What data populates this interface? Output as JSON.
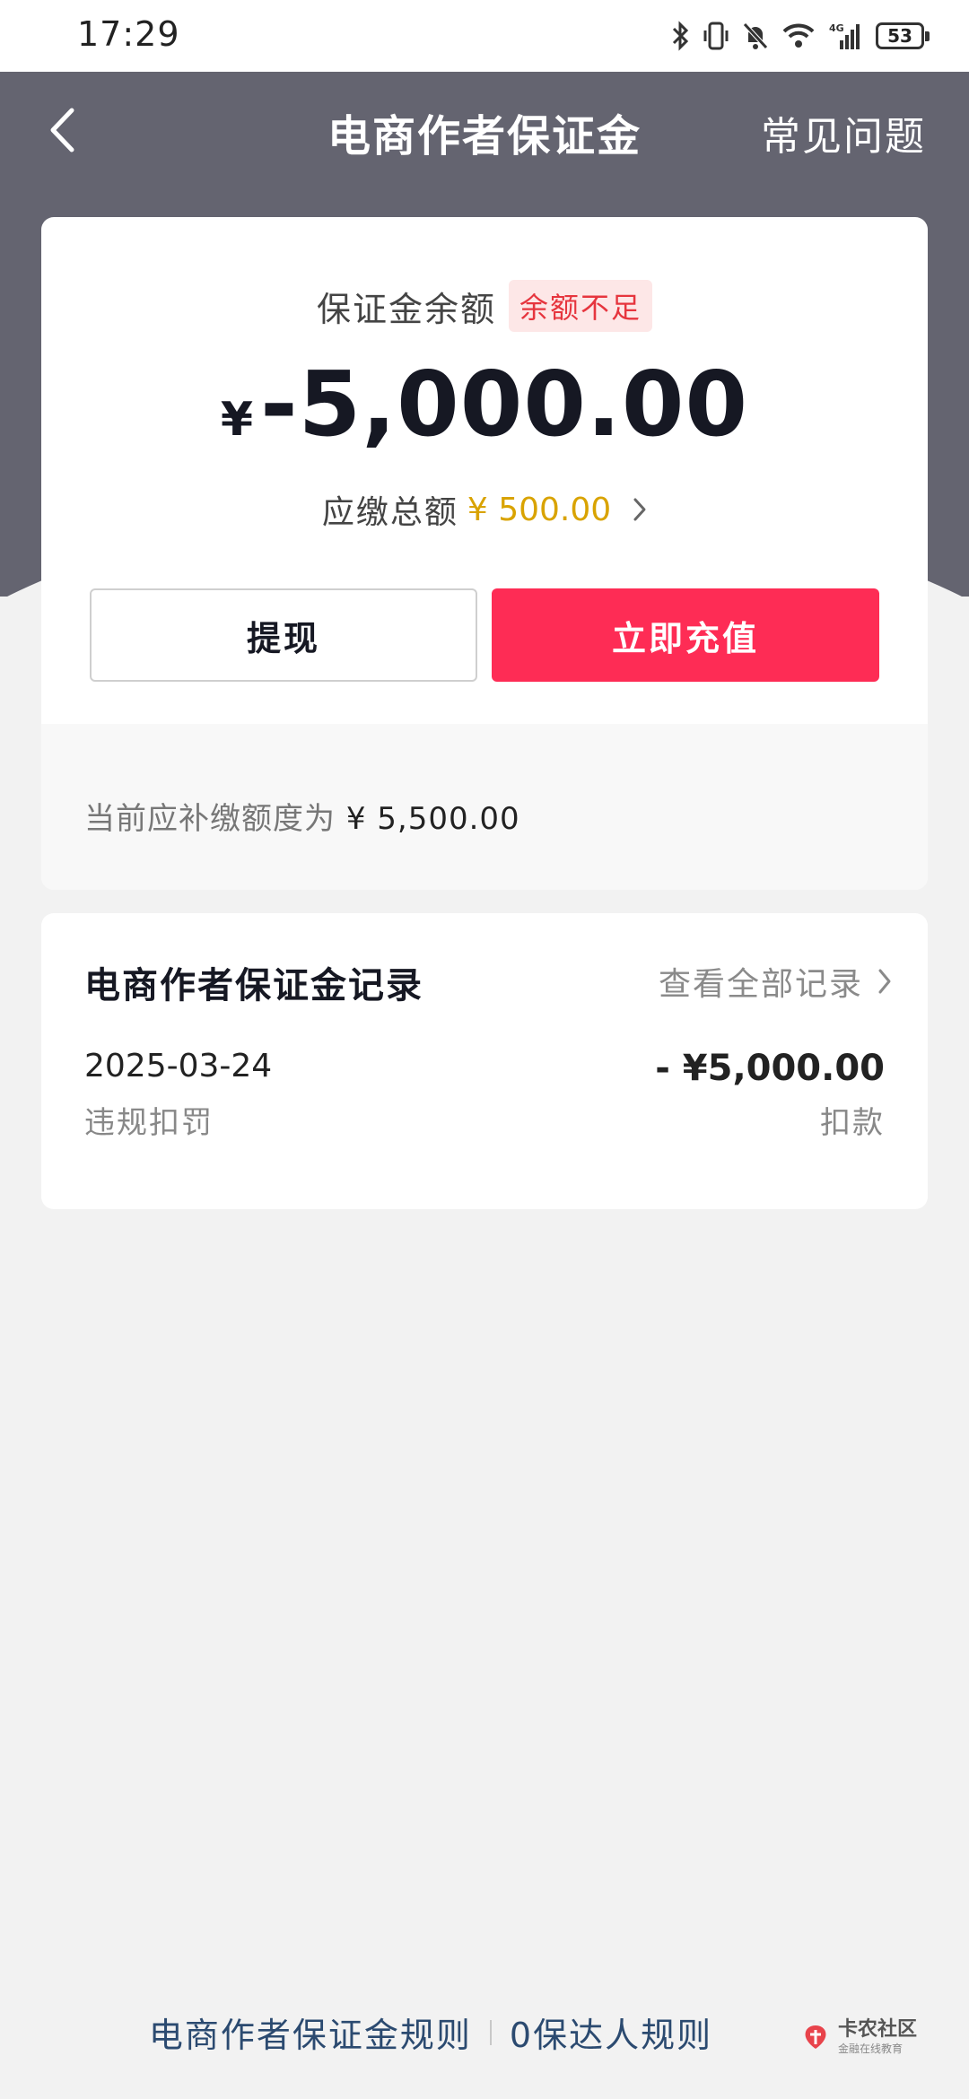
{
  "status_bar": {
    "time": "17:29",
    "battery": "53",
    "network": "4G"
  },
  "nav": {
    "title": "电商作者保证金",
    "faq": "常见问题"
  },
  "balance": {
    "label": "保证金余额",
    "badge": "余额不足",
    "currency": "¥",
    "amount": "-5,000.00",
    "due_label": "应缴总额",
    "due_amount": "¥ 500.00",
    "withdraw_button": "提现",
    "recharge_button": "立即充值",
    "supplement_prefix": "当前应补缴额度为",
    "supplement_amount": "¥ 5,500.00"
  },
  "records": {
    "title": "电商作者保证金记录",
    "view_all": "查看全部记录",
    "items": [
      {
        "date": "2025-03-24",
        "type": "违规扣罚",
        "amount": "- ¥5,000.00",
        "status": "扣款"
      }
    ]
  },
  "footer": {
    "rules_link": "电商作者保证金规则",
    "other_link": "0保达人规则",
    "watermark_main": "卡农社区",
    "watermark_sub": "金融在线教育"
  },
  "colors": {
    "header": "#646470",
    "accent": "#fe2c55",
    "due": "#d9a300",
    "badge_text": "#e6353e",
    "link": "#2b4a70"
  }
}
